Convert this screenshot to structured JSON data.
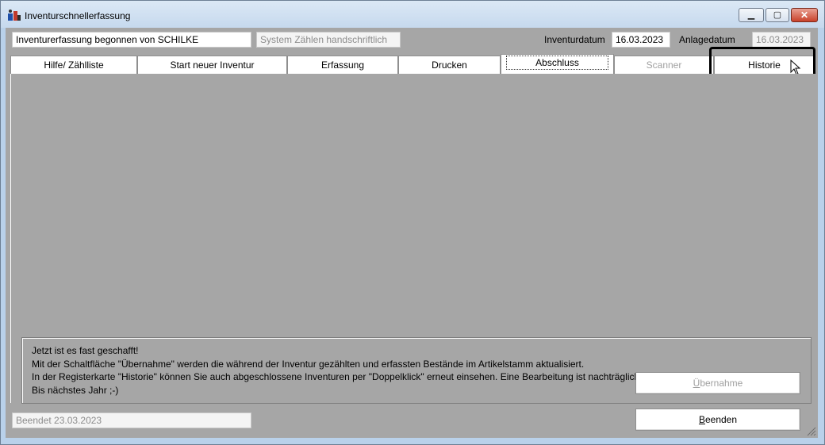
{
  "window": {
    "title": "Inventurschnellerfassung",
    "controls": {
      "minimize": "▁",
      "maximize": "▢",
      "close": "✕"
    }
  },
  "header": {
    "started_by": "Inventurerfassung begonnen von SCHILKE",
    "count_mode": "System Zählen handschriftlich",
    "inventory_date_label": "Inventurdatum",
    "inventory_date": "16.03.2023",
    "created_date_label": "Anlagedatum",
    "created_date": "16.03.2023"
  },
  "tabs": [
    {
      "label": "Hilfe/ Zählliste"
    },
    {
      "label": "Start neuer Inventur"
    },
    {
      "label": "Erfassung"
    },
    {
      "label": "Drucken"
    },
    {
      "label": "Abschluss",
      "state": "active"
    },
    {
      "label": "Scanner",
      "state": "disabled"
    },
    {
      "label": "Historie",
      "state": "highlighted"
    }
  ],
  "info_text": [
    "Jetzt ist es fast geschafft!",
    "Mit der Schaltfläche \"Übernahme\" werden die während der Inventur gezählten und erfassten Bestände im Artikelstamm aktualisiert.",
    "In der Registerkarte \"Historie\" können Sie auch abgeschlossene Inventuren per \"Doppelklick\" erneut einsehen. Eine Bearbeitung ist nachträglich nicht mehr möglich.",
    "Bis nächstes Jahr ;-)"
  ],
  "buttons": {
    "uebernahme": {
      "mnemonic": "Ü",
      "rest": "bernahme",
      "enabled": false
    },
    "beenden": {
      "mnemonic": "B",
      "rest": "eenden",
      "enabled": true
    }
  },
  "status": {
    "finished": "Beendet 23.03.2023"
  },
  "colors": {
    "client_bg": "#a6a6a6",
    "titlebar": "#c6d9ee",
    "close_button": "#c9412a",
    "highlight_border": "#000000"
  }
}
